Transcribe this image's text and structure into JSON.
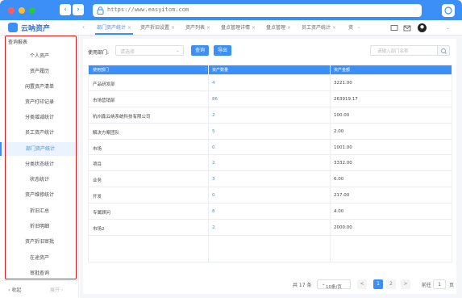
{
  "browser": {
    "url": "https://www.easyitom.com"
  },
  "app": {
    "name": "云呐资产",
    "tabs": [
      {
        "label": "部门资产统计",
        "closable": true,
        "active": true
      },
      {
        "label": "资产折旧设置",
        "closable": true
      },
      {
        "label": "资产列表",
        "closable": true
      },
      {
        "label": "盘点管理详情",
        "closable": true
      },
      {
        "label": "盘点管理",
        "closable": true
      },
      {
        "label": "员工资产统计",
        "closable": true
      },
      {
        "label": "资",
        "closable": false
      }
    ]
  },
  "sidebar": {
    "heading": "查询报表",
    "items": [
      {
        "label": "个人资产"
      },
      {
        "label": "资产履历"
      },
      {
        "label": "闲置资产清单"
      },
      {
        "label": "资产打印记录"
      },
      {
        "label": "分类增减统计"
      },
      {
        "label": "员工资产统计"
      },
      {
        "label": "部门资产统计",
        "active": true
      },
      {
        "label": "分类状态统计"
      },
      {
        "label": "状态统计"
      },
      {
        "label": "资产维修统计"
      },
      {
        "label": "折旧汇总"
      },
      {
        "label": "折旧明细"
      },
      {
        "label": "资产折旧审批"
      },
      {
        "label": "在途资产"
      },
      {
        "label": "审批查询"
      }
    ],
    "footer": {
      "collapse": "收起",
      "expand": "展开"
    }
  },
  "filter": {
    "label": "使用部门:",
    "select_placeholder": "请选择",
    "query_button": "查询",
    "export_button": "导出",
    "search_placeholder": "请输入部门名称"
  },
  "table": {
    "headers": [
      "使用部门",
      "资产数量",
      "资产金额"
    ],
    "rows": [
      {
        "dept": "产品研发部",
        "count": "4",
        "amount": "3221.00"
      },
      {
        "dept": "市场营销部",
        "count": "86",
        "amount": "263919.17"
      },
      {
        "dept": "杭州鑫云纳系统科技有限公司",
        "count": "2",
        "amount": "100.00"
      },
      {
        "dept": "解决方案团队",
        "count": "5",
        "amount": "2.00"
      },
      {
        "dept": "市场",
        "count": "0",
        "amount": "1001.00"
      },
      {
        "dept": "项目",
        "count": "2",
        "amount": "3332.00"
      },
      {
        "dept": "业务",
        "count": "3",
        "amount": "6.00"
      },
      {
        "dept": "开发",
        "count": "0",
        "amount": "217.00"
      },
      {
        "dept": "专属顾问",
        "count": "8",
        "amount": "4.00"
      },
      {
        "dept": "市场2",
        "count": "2",
        "amount": "2000.00"
      }
    ]
  },
  "pagination": {
    "total": "共 17 条",
    "page_size": "10条/页",
    "prev": "<",
    "pages": [
      "1",
      "2"
    ],
    "current": "1",
    "next": ">",
    "goto_label": "前往",
    "goto_value": "1",
    "goto_suffix": "页"
  },
  "colors": {
    "primary": "#3b8ff7",
    "highlight_frame": "#e02020"
  }
}
